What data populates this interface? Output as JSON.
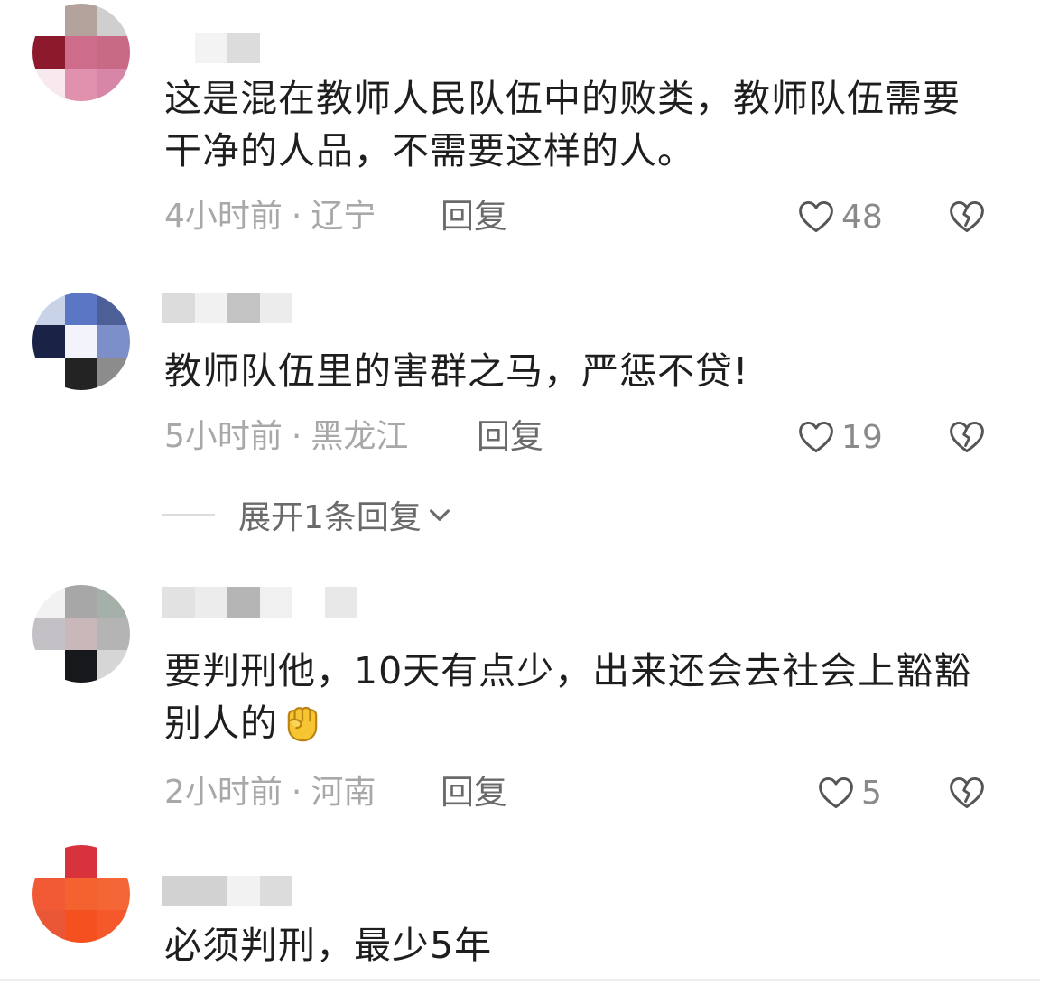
{
  "comments": [
    {
      "text": "这是混在教师人民队伍中的败类，教师队伍需要干净的人品，不需要这样的人。",
      "time": "4小时前",
      "location": "辽宁",
      "reply_label": "回复",
      "likes": "48"
    },
    {
      "text": "教师队伍里的害群之马，严惩不贷!",
      "time": "5小时前",
      "location": "黑龙江",
      "reply_label": "回复",
      "likes": "19"
    },
    {
      "text": "要判刑他，10天有点少，出来还会去社会上豁豁别人的",
      "time": "2小时前",
      "location": "河南",
      "reply_label": "回复",
      "likes": "5",
      "emoji": "raised-fist-emoji"
    },
    {
      "text": "必须判刑，最少5年"
    }
  ],
  "expand_replies_label": "展开1条回复",
  "meta_separator": "·",
  "icons": {
    "like": "heart-outline-icon",
    "dislike": "broken-heart-icon",
    "expand": "chevron-down-icon"
  },
  "colors": {
    "text": "#1e1e1e",
    "meta": "#a8a8a8",
    "action": "#6a6a6a",
    "icon": "#555555"
  }
}
